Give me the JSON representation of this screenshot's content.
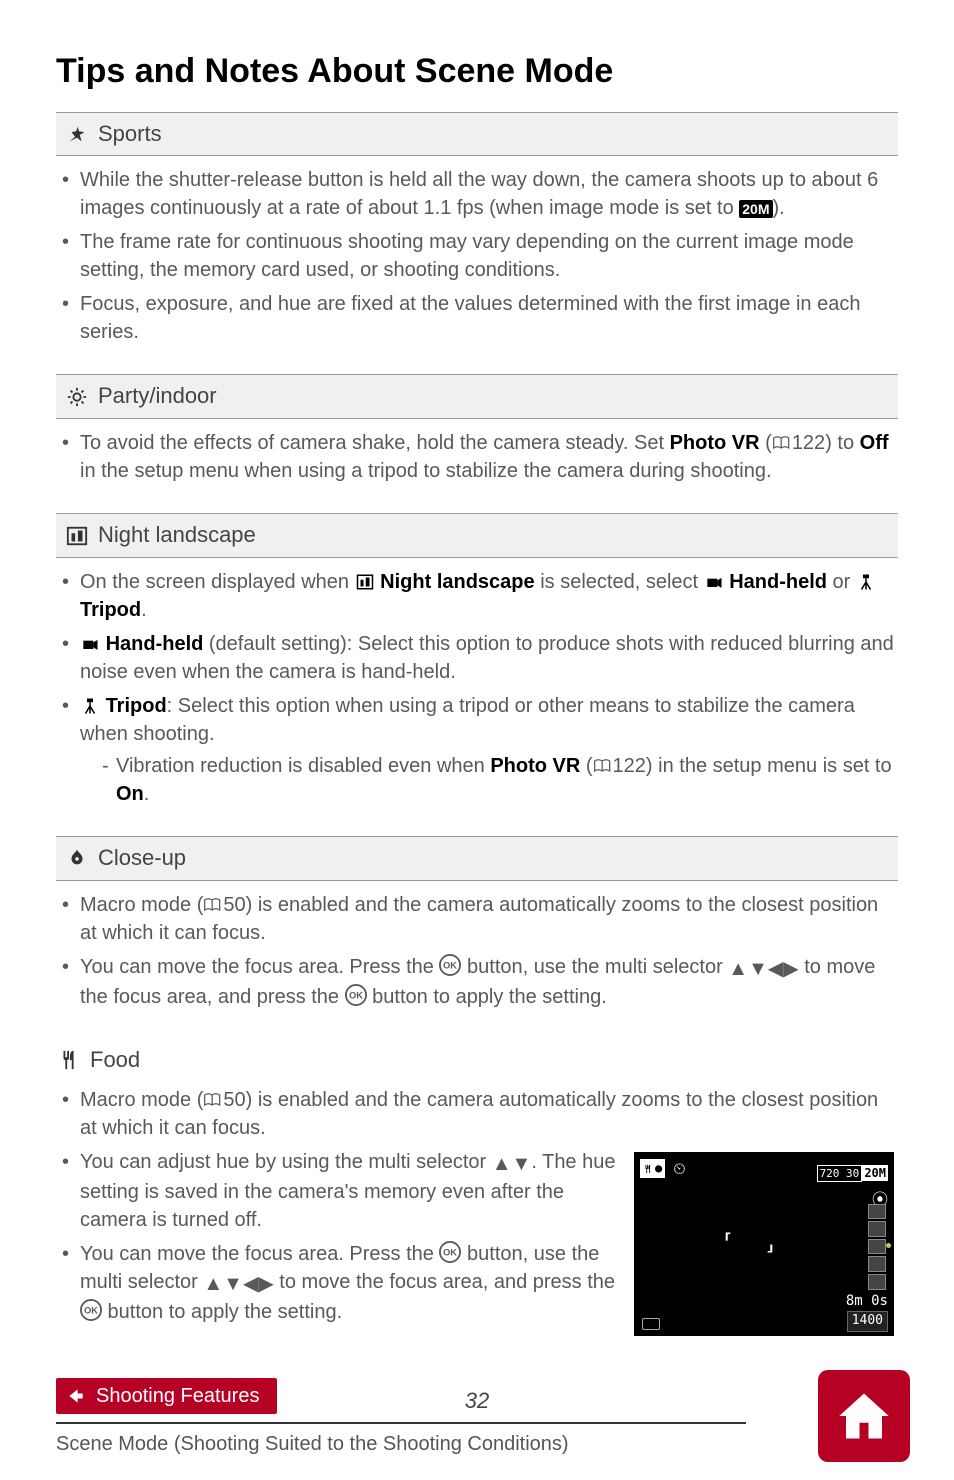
{
  "title": "Tips and Notes About Scene Mode",
  "sections": {
    "sports": {
      "label": "Sports",
      "items": [
        {
          "pre": "While the shutter-release button is held all the way down, the camera shoots up to about 6 images continuously at a rate of about 1.1 fps (when image mode is set to ",
          "badge": "20M",
          "post": ")."
        },
        {
          "text": "The frame rate for continuous shooting may vary depending on the current image mode setting, the memory card used, or shooting conditions."
        },
        {
          "text": "Focus, exposure, and hue are fixed at the values determined with the first image in each series."
        }
      ]
    },
    "party": {
      "label": "Party/indoor",
      "items": [
        {
          "pre": "To avoid the effects of camera shake, hold the camera steady. Set ",
          "bold1": "Photo VR",
          "mid": " (",
          "ref": "122",
          "mid2": ") to ",
          "bold2": "Off",
          "post": " in the setup menu when using a tripod to stabilize the camera during shooting."
        }
      ]
    },
    "night": {
      "label": "Night landscape",
      "items": [
        {
          "pre": "On the screen displayed when ",
          "bold1": "Night landscape",
          "mid": " is selected, select ",
          "bold2": "Hand-held",
          "or": " or ",
          "bold3": "Tripod",
          "post": "."
        },
        {
          "bold": "Hand-held",
          "post": " (default setting): Select this option to produce shots with reduced blurring and noise even when the camera is hand-held."
        },
        {
          "bold": "Tripod",
          "post": ": Select this option when using a tripod or other means to stabilize the camera when shooting.",
          "sub": {
            "pre": "Vibration reduction is disabled even when ",
            "bold": "Photo VR",
            "mid": " (",
            "ref": "122",
            "mid2": ") in the setup menu is set to ",
            "bold2": "On",
            "post": "."
          }
        }
      ]
    },
    "closeup": {
      "label": "Close-up",
      "items": [
        {
          "pre": "Macro mode (",
          "ref": "50",
          "post": ") is enabled and the camera automatically zooms to the closest position at which it can focus."
        },
        {
          "text": "You can move the focus area. Press the ",
          "mid": " button, use the multi selector ",
          "post": " to move the focus area, and press the ",
          "end": " button to apply the setting."
        }
      ]
    },
    "food": {
      "label": "Food",
      "items": [
        {
          "pre": "Macro mode (",
          "ref": "50",
          "post": ") is enabled and the camera automatically zooms to the closest position at which it can focus."
        },
        {
          "text": "You can adjust hue by using the multi selector ",
          "post": ". The hue setting is saved in the camera's memory even after the camera is turned off."
        },
        {
          "text": "You can move the focus area. Press the ",
          "mid": " button, use the multi selector ",
          "post": " to move the focus area, and press the ",
          "end": " button to apply the setting."
        }
      ]
    }
  },
  "preview": {
    "resolution": "720 30",
    "image_mode": "20M",
    "time": "8m 0s",
    "count": "1400"
  },
  "page_number": "32",
  "footer": {
    "crumb": "Shooting Features",
    "sub": "Scene Mode (Shooting Suited to the Shooting Conditions)"
  }
}
